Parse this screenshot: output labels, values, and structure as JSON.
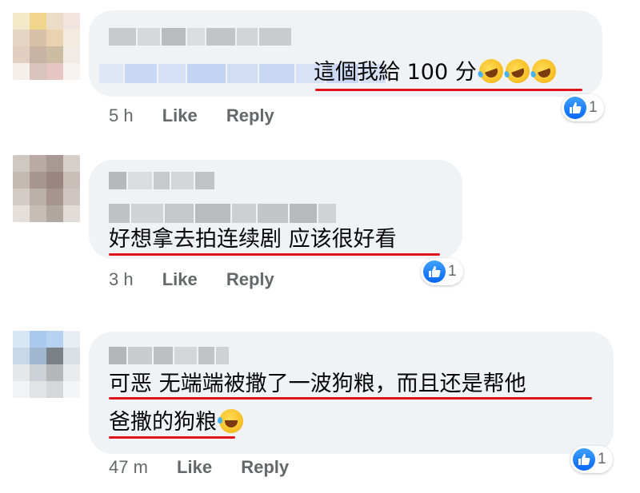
{
  "comments": [
    {
      "text_lines": [
        "這個我給 100 分"
      ],
      "emoji": "rolling-on-floor-laughing-emoji",
      "time": "5 h",
      "like_label": "Like",
      "reply_label": "Reply",
      "reaction_count": "1"
    },
    {
      "text_lines": [
        "好想拿去拍连续剧 应该很好看"
      ],
      "time": "3 h",
      "like_label": "Like",
      "reply_label": "Reply",
      "reaction_count": "1"
    },
    {
      "text_lines": [
        "可恶 无端端被撒了一波狗粮，而且还是帮他",
        "爸撒的狗粮"
      ],
      "emoji": "face-with-tears-of-joy-emoji",
      "time": "47 m",
      "like_label": "Like",
      "reply_label": "Reply",
      "reaction_count": "1"
    }
  ],
  "colors": {
    "bubble": "#f0f2f5",
    "meta_text": "#65676b",
    "underline": "#e0141b",
    "like_blue": "#0866ff"
  }
}
